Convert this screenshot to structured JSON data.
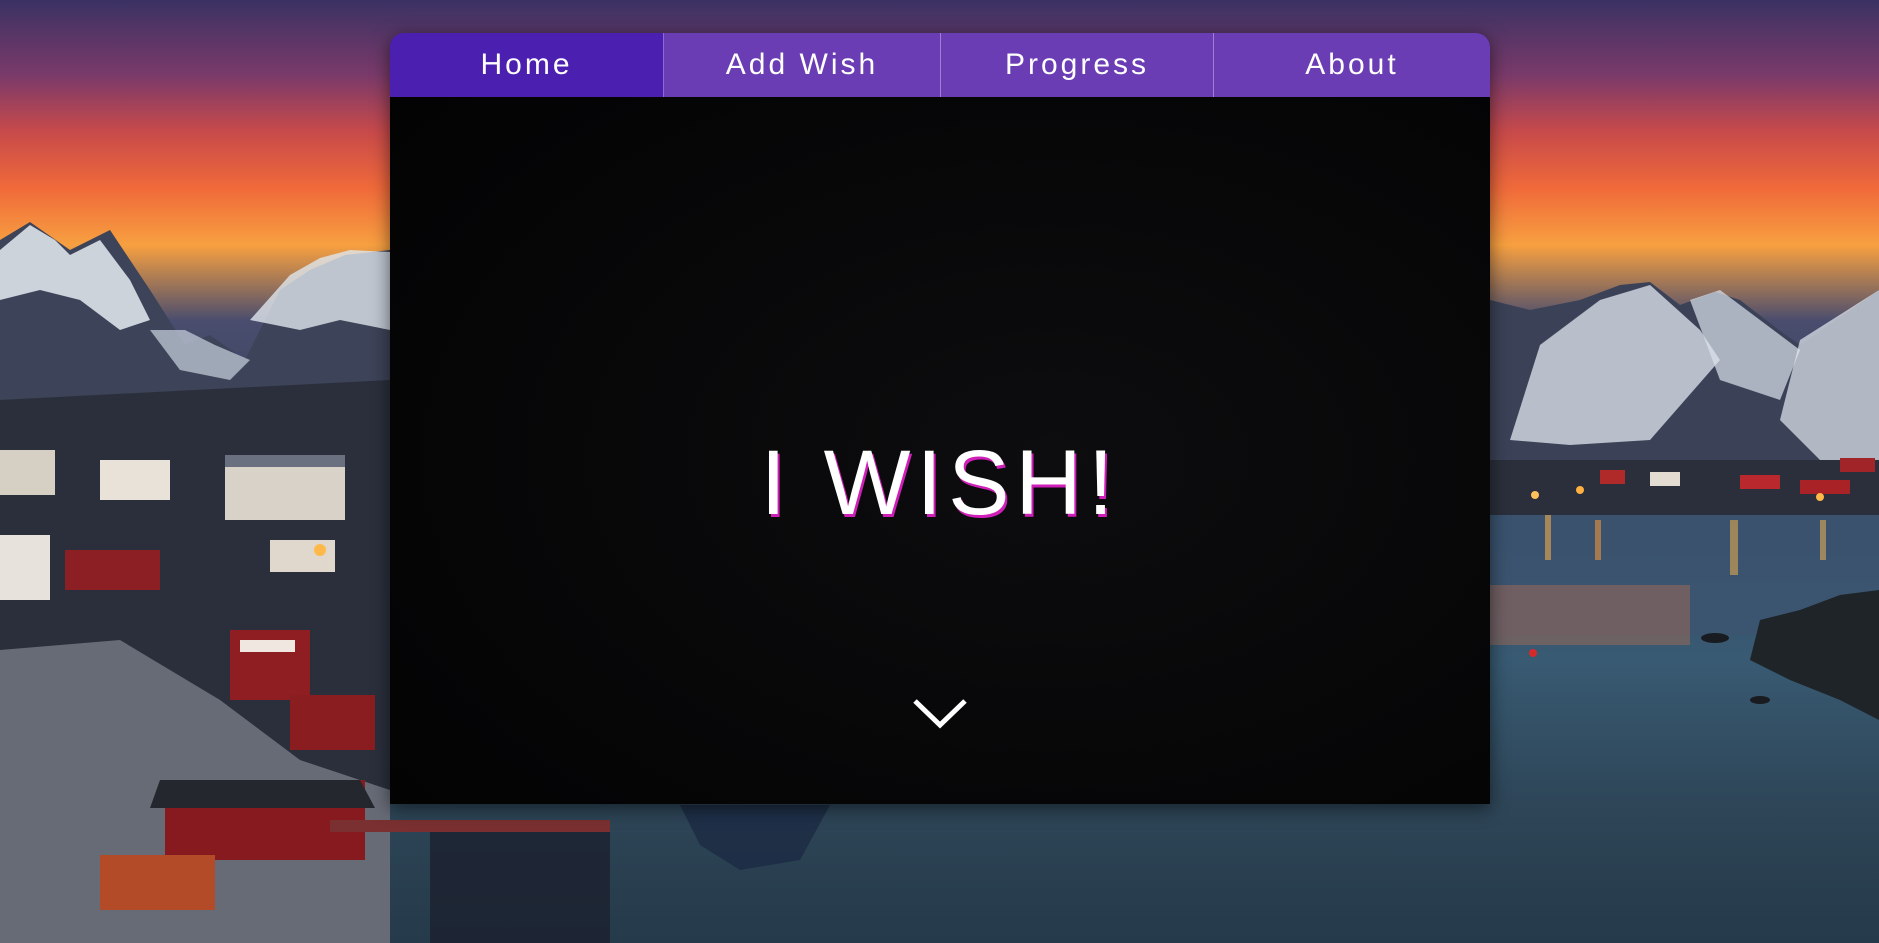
{
  "nav": {
    "items": [
      {
        "label": "Home",
        "active": true
      },
      {
        "label": "Add Wish",
        "active": false
      },
      {
        "label": "Progress",
        "active": false
      },
      {
        "label": "About",
        "active": false
      }
    ]
  },
  "hero": {
    "title": "I WISH!"
  },
  "icons": {
    "scroll": "chevron-down-icon"
  },
  "colors": {
    "nav_bg": "#6a3db4",
    "nav_active": "#4b1fb0",
    "title_shadow": "#d01fb8",
    "card_bg": "#050506"
  }
}
